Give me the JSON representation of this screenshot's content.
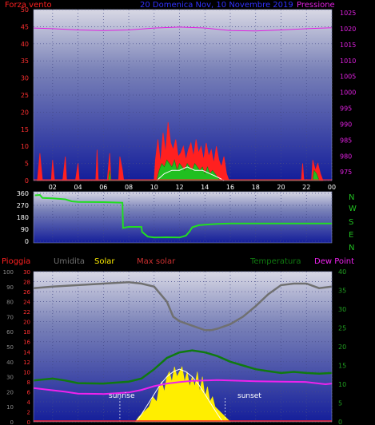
{
  "header": {
    "left_label": "Forza vento",
    "title": "20 Domenica Nov, 10 Novembre 2019",
    "right_label": "Pressione",
    "mid_labels": [
      "Pioggia",
      "Umidita",
      "Solar",
      "Max solar",
      "Temperatura",
      "Dew Point"
    ],
    "compass": [
      "N",
      "W",
      "S",
      "E",
      "N"
    ],
    "sunrise": "sunrise",
    "sunset": "sunset"
  },
  "colors": {
    "wind_red": "#ff2020",
    "pressure_magenta": "#e020e0",
    "green": "#20c020",
    "solar_yellow": "#ffee00",
    "humidity_gray": "#707070",
    "temp_darkgreen": "#107a10",
    "dew_magenta": "#ee22ee",
    "title_blue": "#3030ff"
  },
  "chart_data": [
    {
      "type": "area",
      "name": "wind-pressure",
      "x_ticks": [
        "02",
        "04",
        "06",
        "08",
        "10",
        "12",
        "14",
        "16",
        "18",
        "20",
        "22",
        "00"
      ],
      "x_range": [
        0.5,
        24
      ],
      "left_axis": {
        "label": "Forza vento",
        "range": [
          0,
          50
        ],
        "ticks": [
          0,
          5,
          10,
          15,
          20,
          25,
          30,
          35,
          40,
          45,
          50
        ]
      },
      "right_axis": {
        "label": "Pressione",
        "range": [
          972.3,
          1026
        ],
        "ticks": [
          975,
          980,
          985,
          990,
          995,
          1000,
          1005,
          1010,
          1015,
          1020,
          1025
        ]
      },
      "gust_series": [
        [
          0.8,
          0
        ],
        [
          1.0,
          8
        ],
        [
          1.2,
          0
        ],
        [
          1.9,
          0
        ],
        [
          2.0,
          6
        ],
        [
          2.15,
          0
        ],
        [
          2.8,
          0
        ],
        [
          3.0,
          7
        ],
        [
          3.1,
          0
        ],
        [
          3.8,
          0
        ],
        [
          4.0,
          5
        ],
        [
          4.1,
          0
        ],
        [
          5.4,
          0
        ],
        [
          5.5,
          9
        ],
        [
          5.6,
          0
        ],
        [
          6.3,
          0
        ],
        [
          6.5,
          8
        ],
        [
          6.6,
          0
        ],
        [
          7.2,
          0
        ],
        [
          7.3,
          7
        ],
        [
          7.5,
          3
        ],
        [
          7.6,
          0
        ],
        [
          10.0,
          0
        ],
        [
          10.1,
          6
        ],
        [
          10.3,
          12
        ],
        [
          10.5,
          5
        ],
        [
          10.7,
          14
        ],
        [
          10.9,
          8
        ],
        [
          11.1,
          17
        ],
        [
          11.3,
          11
        ],
        [
          11.5,
          9
        ],
        [
          11.7,
          12
        ],
        [
          11.9,
          7
        ],
        [
          12.1,
          8
        ],
        [
          12.3,
          10
        ],
        [
          12.5,
          6
        ],
        [
          12.7,
          9
        ],
        [
          12.9,
          11
        ],
        [
          13.1,
          7
        ],
        [
          13.3,
          12
        ],
        [
          13.5,
          8
        ],
        [
          13.7,
          10
        ],
        [
          13.9,
          6
        ],
        [
          14.1,
          11
        ],
        [
          14.3,
          7
        ],
        [
          14.5,
          9
        ],
        [
          14.7,
          5
        ],
        [
          14.9,
          10
        ],
        [
          15.1,
          6
        ],
        [
          15.3,
          4
        ],
        [
          15.5,
          7
        ],
        [
          15.7,
          2
        ],
        [
          15.9,
          0
        ],
        [
          21.6,
          0
        ],
        [
          21.7,
          5
        ],
        [
          21.8,
          0
        ],
        [
          22.4,
          0
        ],
        [
          22.5,
          6
        ],
        [
          22.7,
          3
        ],
        [
          22.9,
          5
        ],
        [
          23.1,
          2
        ],
        [
          23.3,
          0
        ]
      ],
      "wind_series": [
        [
          10.2,
          0
        ],
        [
          10.4,
          3
        ],
        [
          10.6,
          5
        ],
        [
          10.8,
          4
        ],
        [
          11.0,
          6
        ],
        [
          11.2,
          5
        ],
        [
          11.4,
          4
        ],
        [
          11.6,
          6
        ],
        [
          11.8,
          3
        ],
        [
          12.0,
          5
        ],
        [
          12.2,
          4
        ],
        [
          12.4,
          3
        ],
        [
          12.6,
          5
        ],
        [
          12.8,
          4
        ],
        [
          13.0,
          3
        ],
        [
          13.2,
          5
        ],
        [
          13.4,
          4
        ],
        [
          13.6,
          3
        ],
        [
          13.8,
          4
        ],
        [
          14.0,
          2
        ],
        [
          14.2,
          4
        ],
        [
          14.4,
          2
        ],
        [
          14.6,
          3
        ],
        [
          14.8,
          2
        ],
        [
          15.0,
          1
        ],
        [
          15.2,
          0
        ],
        [
          6.4,
          0
        ],
        [
          6.5,
          3
        ],
        [
          6.6,
          0
        ],
        [
          22.5,
          0
        ],
        [
          22.6,
          3
        ],
        [
          22.8,
          2
        ],
        [
          23.0,
          0
        ]
      ],
      "avg_series": [
        [
          10.2,
          0
        ],
        [
          10.8,
          2
        ],
        [
          11.4,
          3
        ],
        [
          12.0,
          3
        ],
        [
          12.6,
          4
        ],
        [
          13.2,
          3
        ],
        [
          13.8,
          3
        ],
        [
          14.4,
          2
        ],
        [
          15.0,
          1
        ],
        [
          15.5,
          0
        ]
      ],
      "pressure_series": [
        [
          0.5,
          1020.2
        ],
        [
          2,
          1020.0
        ],
        [
          4,
          1019.6
        ],
        [
          6,
          1019.4
        ],
        [
          8,
          1019.6
        ],
        [
          10,
          1020.2
        ],
        [
          12,
          1020.5
        ],
        [
          14,
          1020.2
        ],
        [
          16,
          1019.4
        ],
        [
          18,
          1019.3
        ],
        [
          20,
          1019.6
        ],
        [
          22,
          1020.0
        ],
        [
          24,
          1020.3
        ]
      ]
    },
    {
      "type": "line",
      "name": "wind-direction",
      "y_ticks": [
        0,
        90,
        180,
        270,
        360
      ],
      "y_range": [
        0,
        360
      ],
      "series": [
        [
          0.6,
          345
        ],
        [
          1.0,
          348
        ],
        [
          1.2,
          325
        ],
        [
          2.0,
          322
        ],
        [
          3.0,
          315
        ],
        [
          3.5,
          300
        ],
        [
          4.0,
          296
        ],
        [
          6.0,
          294
        ],
        [
          7.5,
          290
        ],
        [
          7.55,
          100
        ],
        [
          7.8,
          105
        ],
        [
          8.0,
          108
        ],
        [
          9.0,
          108
        ],
        [
          9.05,
          70
        ],
        [
          9.5,
          35
        ],
        [
          10.0,
          28
        ],
        [
          11.0,
          30
        ],
        [
          12.0,
          28
        ],
        [
          12.5,
          42
        ],
        [
          12.8,
          75
        ],
        [
          13.0,
          105
        ],
        [
          13.5,
          120
        ],
        [
          14.0,
          125
        ],
        [
          15.0,
          130
        ],
        [
          16.0,
          133
        ],
        [
          18,
          133
        ],
        [
          20,
          133
        ],
        [
          22,
          133
        ],
        [
          24,
          133
        ]
      ]
    },
    {
      "type": "area",
      "name": "rain-humidity-solar-temperature",
      "left_axis_outer": {
        "label": "Umidita",
        "range": [
          0,
          100
        ],
        "ticks": [
          0,
          10,
          20,
          30,
          40,
          50,
          60,
          70,
          80,
          90,
          100
        ]
      },
      "left_axis_inner": {
        "label": "Pioggia",
        "range": [
          0,
          30
        ],
        "ticks": [
          0,
          2,
          4,
          6,
          8,
          10,
          12,
          14,
          16,
          18,
          20,
          22,
          24,
          26,
          28,
          30
        ]
      },
      "right_axis": {
        "label": "Temperatura",
        "range": [
          0,
          40
        ],
        "ticks": [
          0,
          5,
          10,
          15,
          20,
          25,
          30,
          35,
          40
        ]
      },
      "humidity_series": [
        [
          0.5,
          89
        ],
        [
          2,
          90
        ],
        [
          4,
          91
        ],
        [
          6,
          92
        ],
        [
          8,
          93
        ],
        [
          9,
          92
        ],
        [
          10,
          90
        ],
        [
          11,
          80
        ],
        [
          11.5,
          70
        ],
        [
          12,
          67
        ],
        [
          13,
          64
        ],
        [
          14,
          61
        ],
        [
          14.5,
          61
        ],
        [
          15,
          62
        ],
        [
          16,
          65
        ],
        [
          17,
          70
        ],
        [
          18,
          77
        ],
        [
          19,
          85
        ],
        [
          20,
          91
        ],
        [
          21,
          92
        ],
        [
          22,
          92
        ],
        [
          23,
          89
        ],
        [
          24,
          90
        ]
      ],
      "temperature_series": [
        [
          0.5,
          11
        ],
        [
          2,
          11.5
        ],
        [
          3,
          11
        ],
        [
          4,
          10.3
        ],
        [
          6,
          10.2
        ],
        [
          8,
          10.7
        ],
        [
          9,
          11.5
        ],
        [
          10,
          14
        ],
        [
          11,
          17
        ],
        [
          12,
          18.5
        ],
        [
          13,
          19
        ],
        [
          14,
          18.5
        ],
        [
          15,
          17.5
        ],
        [
          16,
          16
        ],
        [
          17,
          15
        ],
        [
          18,
          14
        ],
        [
          19,
          13.5
        ],
        [
          20,
          13
        ],
        [
          21,
          13.3
        ],
        [
          22,
          13
        ],
        [
          23,
          12.8
        ],
        [
          24,
          13
        ]
      ],
      "dew_point_series": [
        [
          0.5,
          9
        ],
        [
          1.5,
          8.6
        ],
        [
          3,
          8.0
        ],
        [
          4,
          7.5
        ],
        [
          6,
          7.4
        ],
        [
          8,
          7.8
        ],
        [
          9,
          8.5
        ],
        [
          10,
          9.5
        ],
        [
          11,
          10.2
        ],
        [
          12,
          10.6
        ],
        [
          13,
          10.9
        ],
        [
          14,
          11.0
        ],
        [
          15,
          11.1
        ],
        [
          16,
          11.0
        ],
        [
          18,
          10.8
        ],
        [
          20,
          10.7
        ],
        [
          22,
          10.6
        ],
        [
          23.5,
          10.0
        ],
        [
          24,
          10.2
        ]
      ],
      "solar_series": [
        [
          8.5,
          0
        ],
        [
          8.8,
          1
        ],
        [
          9.2,
          2
        ],
        [
          9.6,
          3
        ],
        [
          9.9,
          5
        ],
        [
          10.2,
          4
        ],
        [
          10.4,
          7
        ],
        [
          10.6,
          8
        ],
        [
          10.8,
          6
        ],
        [
          11.0,
          9
        ],
        [
          11.2,
          10
        ],
        [
          11.4,
          8
        ],
        [
          11.6,
          11
        ],
        [
          11.8,
          9
        ],
        [
          12.0,
          10
        ],
        [
          12.2,
          11
        ],
        [
          12.4,
          8
        ],
        [
          12.6,
          10
        ],
        [
          12.8,
          7
        ],
        [
          13.0,
          9
        ],
        [
          13.2,
          7
        ],
        [
          13.4,
          10
        ],
        [
          13.6,
          6
        ],
        [
          13.8,
          9
        ],
        [
          14.0,
          5
        ],
        [
          14.2,
          7
        ],
        [
          14.4,
          4
        ],
        [
          14.6,
          5
        ],
        [
          14.8,
          3
        ],
        [
          15.2,
          2
        ],
        [
          15.6,
          1
        ],
        [
          16.0,
          0
        ]
      ],
      "max_solar_series": [
        [
          8.6,
          0
        ],
        [
          9,
          1.5
        ],
        [
          9.5,
          3.5
        ],
        [
          10,
          5.5
        ],
        [
          10.5,
          7.5
        ],
        [
          11,
          9
        ],
        [
          11.5,
          10
        ],
        [
          12,
          10.5
        ],
        [
          12.5,
          10
        ],
        [
          13,
          9
        ],
        [
          13.5,
          7.5
        ],
        [
          14,
          5.5
        ],
        [
          14.5,
          3.5
        ],
        [
          15,
          1.5
        ],
        [
          15.4,
          0
        ]
      ],
      "sunrise_x": 7.3,
      "sunset_x": 15.6
    }
  ]
}
